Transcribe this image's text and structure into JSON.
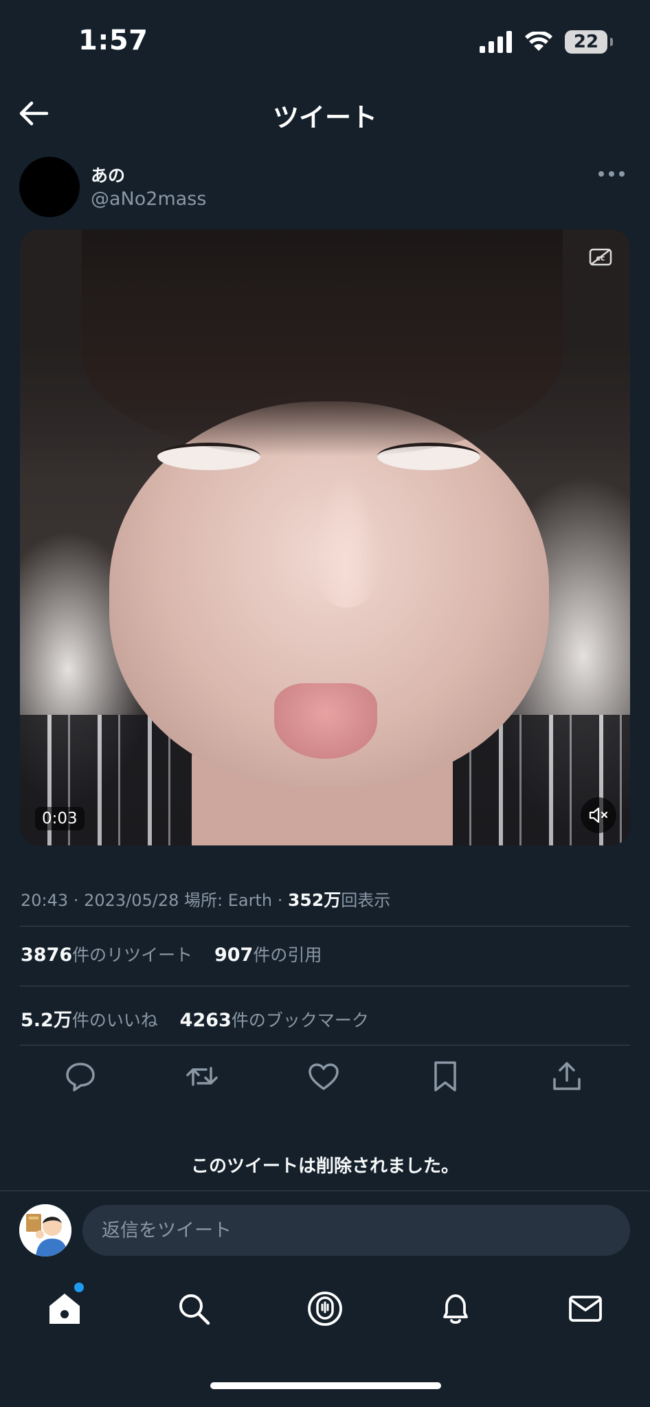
{
  "status_bar": {
    "time": "1:57",
    "battery": "22"
  },
  "header": {
    "title": "ツイート"
  },
  "author": {
    "name": "あの",
    "handle": "@aNo2mass"
  },
  "media": {
    "duration": "0:03",
    "muted": true
  },
  "meta": {
    "time": "20:43",
    "date": "2023/05/28",
    "location_label": "場所: Earth",
    "views_count": "352万",
    "views_label": "回表示"
  },
  "stats": {
    "retweets_count": "3876",
    "retweets_label": "件のリツイート",
    "quotes_count": "907",
    "quotes_label": "件の引用",
    "likes_count": "5.2万",
    "likes_label": "件のいいね",
    "bookmarks_count": "4263",
    "bookmarks_label": "件のブックマーク"
  },
  "actions": [
    "reply-icon",
    "retweet-icon",
    "like-icon",
    "bookmark-icon",
    "share-icon"
  ],
  "deleted_notice": "このツイートは削除されました。",
  "reply": {
    "placeholder": "返信をツイート"
  },
  "tab_bar": [
    "home-icon",
    "search-icon",
    "spaces-icon",
    "notifications-icon",
    "messages-icon"
  ],
  "colors": {
    "background": "#15202b",
    "text_primary": "#f7f9f9",
    "text_secondary": "#8b98a5",
    "divider": "#38444d",
    "accent": "#1d9bf0"
  }
}
